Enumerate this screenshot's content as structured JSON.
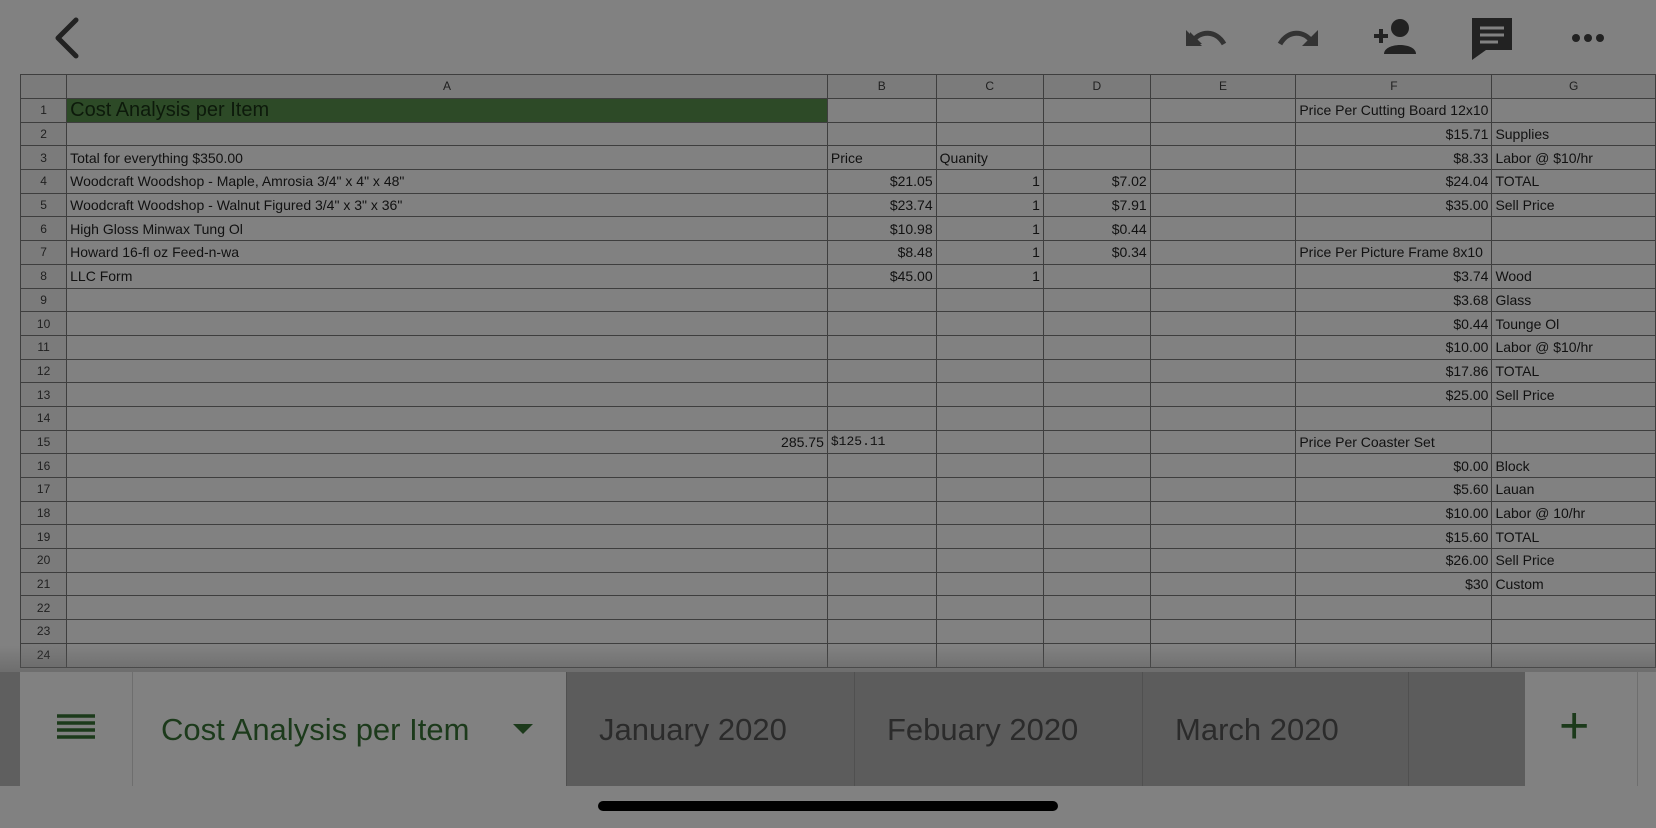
{
  "toolbar": {
    "back_icon": "chevron-left-icon",
    "undo_icon": "undo-icon",
    "redo_icon": "redo-icon",
    "share_icon": "add-person-icon",
    "comment_icon": "comment-icon",
    "more_icon": "more-horizontal-icon"
  },
  "columns": [
    "A",
    "B",
    "C",
    "D",
    "E",
    "F",
    "G"
  ],
  "rows": [
    {
      "n": "1",
      "a": "Cost Analysis per Item",
      "b": "",
      "c": "",
      "d": "",
      "e": "",
      "f": "Price Per Cutting Board 12x10",
      "g": ""
    },
    {
      "n": "2",
      "a": "",
      "b": "",
      "c": "",
      "d": "",
      "e": "",
      "f": "$15.71",
      "g": "Supplies"
    },
    {
      "n": "3",
      "a": "Total for everything $350.00",
      "b": "Price",
      "c": "Quanity",
      "d": "",
      "e": "",
      "f": "$8.33",
      "g": "Labor @ $10/hr"
    },
    {
      "n": "4",
      "a": "Woodcraft Woodshop - Maple, Amrosia 3/4\" x 4\" x 48\"",
      "b": "$21.05",
      "c": "1",
      "d": "$7.02",
      "e": "",
      "f": "$24.04",
      "g": "TOTAL"
    },
    {
      "n": "5",
      "a": "Woodcraft Woodshop - Walnut Figured 3/4\" x 3\" x 36\"",
      "b": "$23.74",
      "c": "1",
      "d": "$7.91",
      "e": "",
      "f": "$35.00",
      "g": "Sell Price"
    },
    {
      "n": "6",
      "a": "High Gloss Minwax Tung Ol",
      "b": "$10.98",
      "c": "1",
      "d": "$0.44",
      "e": "",
      "f": "",
      "g": ""
    },
    {
      "n": "7",
      "a": "Howard 16-fl oz Feed-n-wa",
      "b": "$8.48",
      "c": "1",
      "d": "$0.34",
      "e": "",
      "f": "Price Per Picture Frame 8x10",
      "g": ""
    },
    {
      "n": "8",
      "a": "LLC Form",
      "b": "$45.00",
      "c": "1",
      "d": "",
      "e": "",
      "f": "$3.74",
      "g": "Wood"
    },
    {
      "n": "9",
      "a": "",
      "b": "",
      "c": "",
      "d": "",
      "e": "",
      "f": "$3.68",
      "g": "Glass"
    },
    {
      "n": "10",
      "a": "",
      "b": "",
      "c": "",
      "d": "",
      "e": "",
      "f": "$0.44",
      "g": "Tounge Ol"
    },
    {
      "n": "11",
      "a": "",
      "b": "",
      "c": "",
      "d": "",
      "e": "",
      "f": "$10.00",
      "g": "Labor @ $10/hr"
    },
    {
      "n": "12",
      "a": "",
      "b": "",
      "c": "",
      "d": "",
      "e": "",
      "f": "$17.86",
      "g": "TOTAL"
    },
    {
      "n": "13",
      "a": "",
      "b": "",
      "c": "",
      "d": "",
      "e": "",
      "f": "$25.00",
      "g": "Sell Price"
    },
    {
      "n": "14",
      "a": "",
      "b": "",
      "c": "",
      "d": "",
      "e": "",
      "f": "",
      "g": ""
    },
    {
      "n": "15",
      "a": "285.75",
      "b": "$125.11",
      "c": "",
      "d": "",
      "e": "",
      "f": "Price Per Coaster Set",
      "g": ""
    },
    {
      "n": "16",
      "a": "",
      "b": "",
      "c": "",
      "d": "",
      "e": "",
      "f": "$0.00",
      "g": "Block"
    },
    {
      "n": "17",
      "a": "",
      "b": "",
      "c": "",
      "d": "",
      "e": "",
      "f": "$5.60",
      "g": "Lauan"
    },
    {
      "n": "18",
      "a": "",
      "b": "",
      "c": "",
      "d": "",
      "e": "",
      "f": "$10.00",
      "g": "Labor @ 10/hr"
    },
    {
      "n": "19",
      "a": "",
      "b": "",
      "c": "",
      "d": "",
      "e": "",
      "f": "$15.60",
      "g": "TOTAL"
    },
    {
      "n": "20",
      "a": "",
      "b": "",
      "c": "",
      "d": "",
      "e": "",
      "f": "$26.00",
      "g": "Sell Price"
    },
    {
      "n": "21",
      "a": "",
      "b": "",
      "c": "",
      "d": "",
      "e": "",
      "f": "$30",
      "g": "Custom"
    },
    {
      "n": "22",
      "a": "",
      "b": "",
      "c": "",
      "d": "",
      "e": "",
      "f": "",
      "g": ""
    },
    {
      "n": "23",
      "a": "",
      "b": "",
      "c": "",
      "d": "",
      "e": "",
      "f": "",
      "g": ""
    },
    {
      "n": "24",
      "a": "",
      "b": "",
      "c": "",
      "d": "",
      "e": "",
      "f": "",
      "g": ""
    }
  ],
  "tabs": {
    "menu_icon": "hamburger-menu-icon",
    "active": "Cost Analysis per Item",
    "active_dropdown_icon": "caret-down-icon",
    "others": [
      "January 2020",
      "Febuary 2020",
      "March 2020"
    ],
    "add_icon": "plus-icon",
    "add_label": "+"
  },
  "colors": {
    "title_fill": "#2d4a27",
    "accent": "#1c3a1b"
  }
}
